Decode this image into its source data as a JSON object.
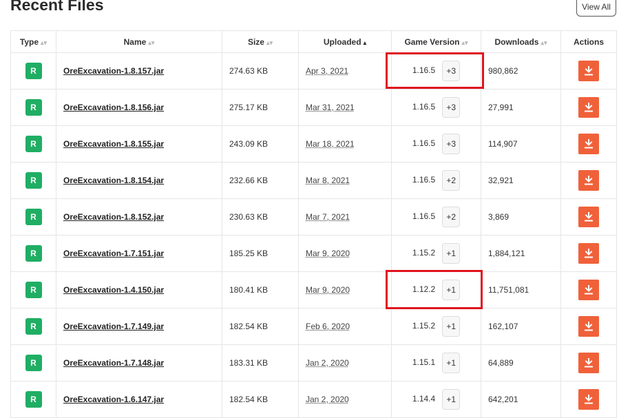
{
  "page": {
    "title": "Recent Files",
    "view_all_label": "View All"
  },
  "table": {
    "headers": {
      "type": "Type",
      "name": "Name",
      "size": "Size",
      "uploaded": "Uploaded",
      "game_version": "Game Version",
      "downloads": "Downloads",
      "actions": "Actions"
    },
    "rows": [
      {
        "type": "R",
        "name": "OreExcavation-1.8.157.jar",
        "size": "274.63 KB",
        "uploaded": "Apr 3, 2021",
        "game_version": "1.16.5",
        "extra": "+3",
        "downloads": "980,862"
      },
      {
        "type": "R",
        "name": "OreExcavation-1.8.156.jar",
        "size": "275.17 KB",
        "uploaded": "Mar 31, 2021",
        "game_version": "1.16.5",
        "extra": "+3",
        "downloads": "27,991"
      },
      {
        "type": "R",
        "name": "OreExcavation-1.8.155.jar",
        "size": "243.09 KB",
        "uploaded": "Mar 18, 2021",
        "game_version": "1.16.5",
        "extra": "+3",
        "downloads": "114,907"
      },
      {
        "type": "R",
        "name": "OreExcavation-1.8.154.jar",
        "size": "232.66 KB",
        "uploaded": "Mar 8, 2021",
        "game_version": "1.16.5",
        "extra": "+2",
        "downloads": "32,921"
      },
      {
        "type": "R",
        "name": "OreExcavation-1.8.152.jar",
        "size": "230.63 KB",
        "uploaded": "Mar 7, 2021",
        "game_version": "1.16.5",
        "extra": "+2",
        "downloads": "3,869"
      },
      {
        "type": "R",
        "name": "OreExcavation-1.7.151.jar",
        "size": "185.25 KB",
        "uploaded": "Mar 9, 2020",
        "game_version": "1.15.2",
        "extra": "+1",
        "downloads": "1,884,121"
      },
      {
        "type": "R",
        "name": "OreExcavation-1.4.150.jar",
        "size": "180.41 KB",
        "uploaded": "Mar 9, 2020",
        "game_version": "1.12.2",
        "extra": "+1",
        "downloads": "11,751,081"
      },
      {
        "type": "R",
        "name": "OreExcavation-1.7.149.jar",
        "size": "182.54 KB",
        "uploaded": "Feb 6, 2020",
        "game_version": "1.15.2",
        "extra": "+1",
        "downloads": "162,107"
      },
      {
        "type": "R",
        "name": "OreExcavation-1.7.148.jar",
        "size": "183.31 KB",
        "uploaded": "Jan 2, 2020",
        "game_version": "1.15.1",
        "extra": "+1",
        "downloads": "64,889"
      },
      {
        "type": "R",
        "name": "OreExcavation-1.6.147.jar",
        "size": "182.54 KB",
        "uploaded": "Jan 2, 2020",
        "game_version": "1.14.4",
        "extra": "+1",
        "downloads": "642,201"
      }
    ]
  },
  "colors": {
    "release_badge": "#1fae64",
    "download_button": "#f0613a",
    "highlight": "#e0141e"
  },
  "icons": {
    "sort": "sort-icon",
    "sort_active": "sort-asc-icon",
    "download": "download-icon"
  }
}
